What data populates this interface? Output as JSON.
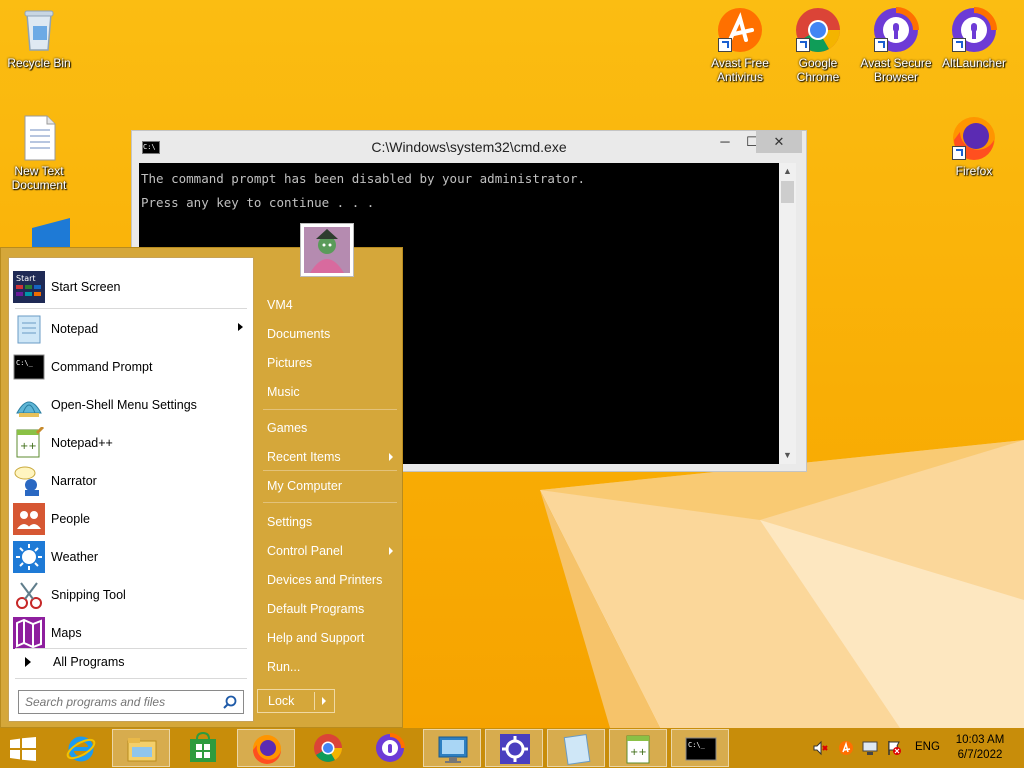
{
  "desktop": {
    "icons": [
      {
        "label": "Recycle Bin"
      },
      {
        "label": "New Text Document"
      },
      {
        "label": "Avast Free Antivirus"
      },
      {
        "label": "Google Chrome"
      },
      {
        "label": "Avast Secure Browser"
      },
      {
        "label": "AltLauncher"
      },
      {
        "label": "Firefox"
      }
    ]
  },
  "cmd": {
    "title": "C:\\Windows\\system32\\cmd.exe",
    "icon_text": "C:\\",
    "lines": [
      "The command prompt has been disabled by your administrator.",
      "Press any key to continue . . ."
    ],
    "min": "─",
    "max": "☐",
    "close": "✕"
  },
  "start_menu": {
    "left_items": [
      {
        "label": "Start Screen",
        "icon": "start-screen-icon"
      },
      {
        "label": "Notepad",
        "icon": "notepad-icon",
        "submenu": true
      },
      {
        "label": "Command Prompt",
        "icon": "command-prompt-icon"
      },
      {
        "label": "Open-Shell Menu Settings",
        "icon": "shell-icon"
      },
      {
        "label": "Notepad++",
        "icon": "notepad-plus-plus-icon"
      },
      {
        "label": "Narrator",
        "icon": "narrator-icon"
      },
      {
        "label": "People",
        "icon": "people-icon"
      },
      {
        "label": "Weather",
        "icon": "weather-icon"
      },
      {
        "label": "Snipping Tool",
        "icon": "snipping-tool-icon"
      },
      {
        "label": "Maps",
        "icon": "maps-icon"
      }
    ],
    "start_icon_text": "Start",
    "all_programs": "All Programs",
    "search_placeholder": "Search programs and files",
    "right_items": [
      {
        "label": "VM4"
      },
      {
        "label": "Documents"
      },
      {
        "label": "Pictures"
      },
      {
        "label": "Music"
      },
      {
        "label": "Games"
      },
      {
        "label": "Recent Items",
        "submenu": true
      },
      {
        "label": "My Computer"
      },
      {
        "label": "Settings"
      },
      {
        "label": "Control Panel",
        "submenu": true
      },
      {
        "label": "Devices and Printers"
      },
      {
        "label": "Default Programs"
      },
      {
        "label": "Help and Support"
      },
      {
        "label": "Run..."
      }
    ],
    "lock": "Lock"
  },
  "taskbar": {
    "apps": [
      "start-button",
      "internet-explorer-icon",
      "file-explorer-icon",
      "store-icon",
      "firefox-icon",
      "chrome-icon",
      "avast-secure-browser-icon",
      "remote-desktop-icon",
      "settings-gear-icon",
      "notepad-icon",
      "notepad-plus-plus-icon",
      "command-prompt-icon"
    ],
    "lang": "ENG",
    "time": "10:03 AM",
    "date": "6/7/2022"
  },
  "colors": {
    "desktop": "#f9ae05",
    "taskbar": "#c88d0a",
    "start_menu": "#d5a73a"
  }
}
